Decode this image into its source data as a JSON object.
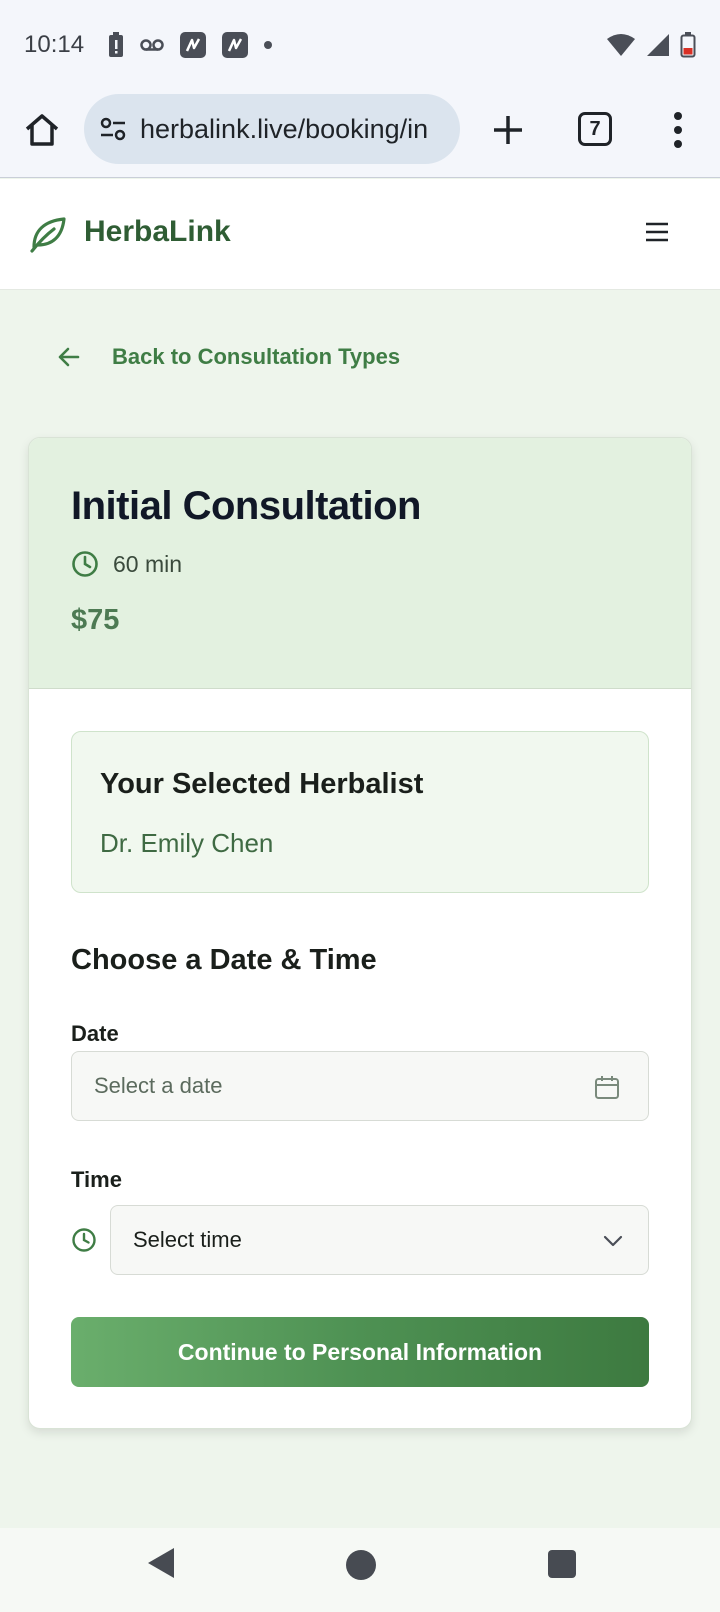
{
  "status_bar": {
    "time": "10:14",
    "icons": [
      "battery-alert-icon",
      "voicemail-icon",
      "app-notification-icon",
      "app-notification-icon",
      "dot-icon"
    ],
    "right_icons": [
      "wifi-icon",
      "signal-icon",
      "battery-low-icon"
    ]
  },
  "browser": {
    "url": "herbalink.live/booking/in",
    "tab_count": "7"
  },
  "site": {
    "brand": "HerbaLink",
    "colors": {
      "brand_green": "#2f5d34",
      "accent": "#4e9153",
      "header_bg": "#e3f1e0"
    }
  },
  "back_link": "Back to Consultation Types",
  "consultation": {
    "title": "Initial Consultation",
    "duration": "60 min",
    "price": "$75"
  },
  "herbalist": {
    "heading": "Your Selected Herbalist",
    "name": "Dr. Emily Chen"
  },
  "schedule": {
    "heading": "Choose a Date & Time",
    "date_label": "Date",
    "date_placeholder": "Select a date",
    "time_label": "Time",
    "time_selected": "Select time"
  },
  "continue_label": "Continue to Personal Information"
}
